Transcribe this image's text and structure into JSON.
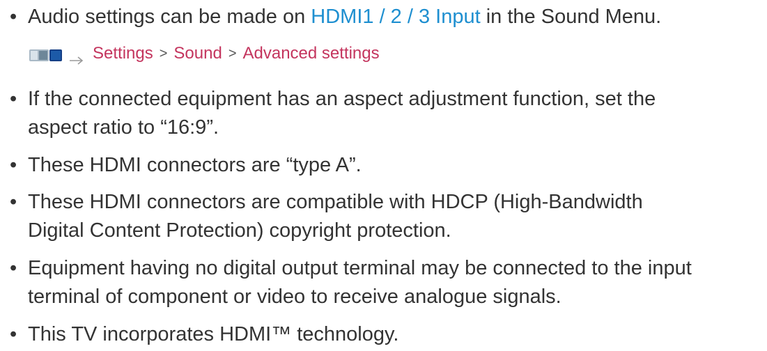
{
  "items": [
    {
      "before": "Audio settings can be made on ",
      "link": "HDMI1 / 2 / 3 Input",
      "after": " in the Sound Menu."
    },
    {
      "line1": "If the connected equipment has an aspect adjustment function, set the",
      "line2": "aspect ratio to “16:9”."
    },
    {
      "line1": "These HDMI connectors are “type A”."
    },
    {
      "line1": "These HDMI connectors are compatible with HDCP (High-Bandwidth",
      "line2": "Digital Content Protection) copyright protection."
    },
    {
      "line1": "Equipment having no digital output terminal may be connected to the input",
      "line2": "terminal of component or video to receive analogue signals."
    },
    {
      "line1": "This TV incorporates HDMI™ technology."
    }
  ],
  "menu_path": {
    "icon": "menu-button-icon",
    "crumbs": [
      "Settings",
      "Sound",
      "Advanced settings"
    ],
    "separator": ">"
  },
  "colors": {
    "text": "#333333",
    "link": "#1e8fd0",
    "crumb": "#c4355e"
  }
}
